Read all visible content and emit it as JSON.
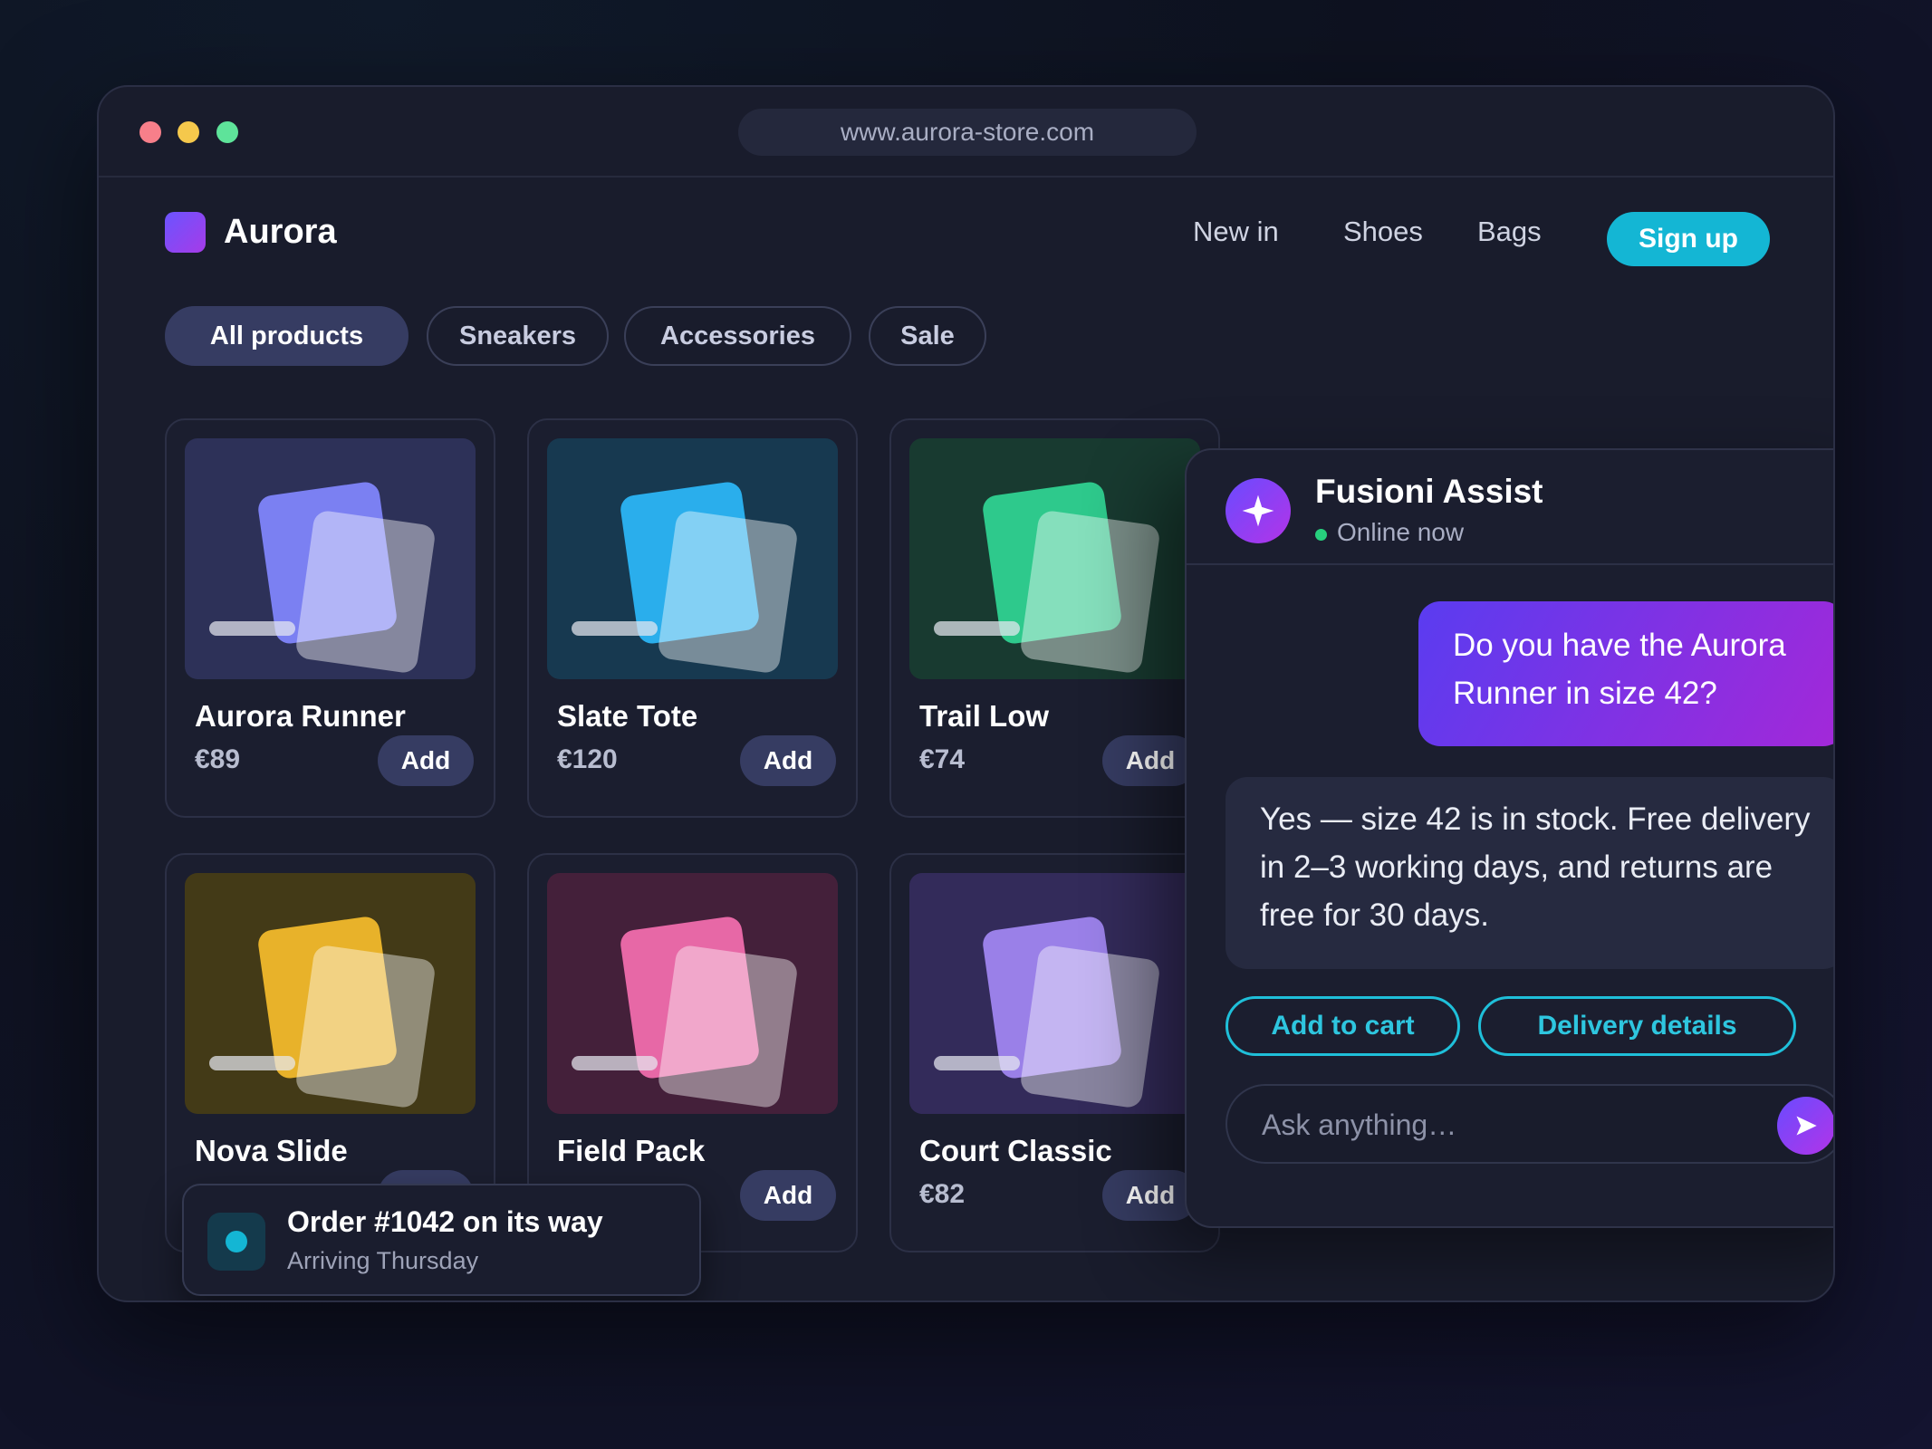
{
  "browser": {
    "url": "www.aurora-store.com"
  },
  "header": {
    "brand": "Aurora",
    "nav": [
      "New in",
      "Shoes",
      "Bags"
    ],
    "signup_label": "Sign up"
  },
  "filters": [
    "All products",
    "Sneakers",
    "Accessories",
    "Sale"
  ],
  "active_filter": "All products",
  "products": [
    {
      "name": "Aurora Runner",
      "price": "€89",
      "add": "Add",
      "color": "#7b80f2",
      "bg": "#2d3158"
    },
    {
      "name": "Slate Tote",
      "price": "€120",
      "add": "Add",
      "color": "#2aaeec",
      "bg": "#173950"
    },
    {
      "name": "Trail Low",
      "price": "€74",
      "add": "Add",
      "color": "#2ec98c",
      "bg": "#183a30"
    },
    {
      "name": "Nova Slide",
      "price": "",
      "add": "",
      "color": "#e8b22a",
      "bg": "#433a17"
    },
    {
      "name": "Field Pack",
      "price": "",
      "add": "Add",
      "color": "#e768a6",
      "bg": "#44203a"
    },
    {
      "name": "Court Classic",
      "price": "€82",
      "add": "Add",
      "color": "#9a80e8",
      "bg": "#332b5a"
    }
  ],
  "toast": {
    "title": "Order #1042 on its way",
    "subtitle": "Arriving Thursday"
  },
  "chat": {
    "name": "Fusioni Assist",
    "status": "Online now",
    "user_message": "Do you have the Aurora Runner in size 42?",
    "bot_message": "Yes — size 42 is in stock. Free delivery in 2–3 working days, and returns are free for 30 days.",
    "quick_replies": [
      "Add to cart",
      "Delivery details"
    ],
    "input_placeholder": "Ask anything…"
  },
  "colors": {
    "accent": "#14b6d4",
    "brand": "#7b4df2",
    "online": "#27d07d"
  }
}
